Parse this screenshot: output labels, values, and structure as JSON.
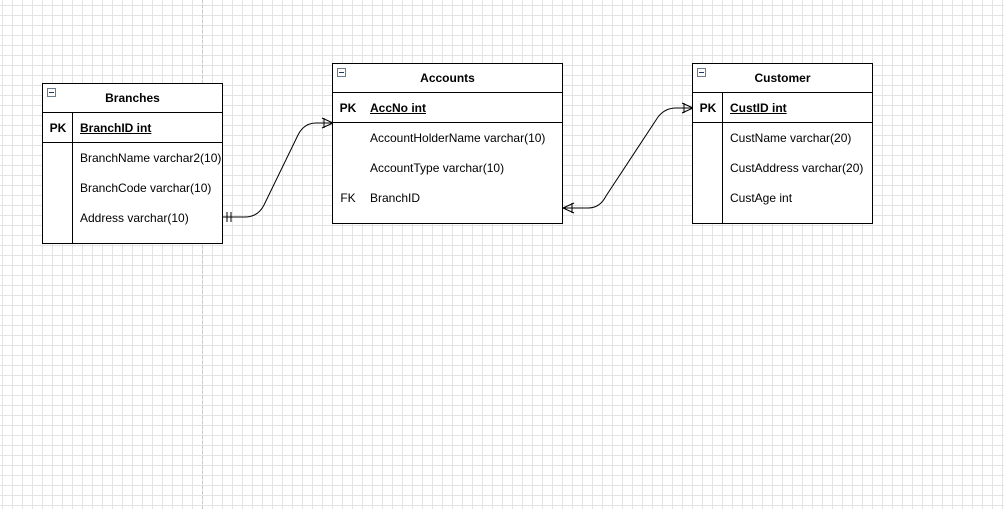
{
  "diagram": {
    "entities": [
      {
        "id": "branches",
        "title": "Branches",
        "pk": {
          "key": "PK",
          "field": "BranchID int"
        },
        "fields": [
          {
            "key": "",
            "field": "BranchName varchar2(10)"
          },
          {
            "key": "",
            "field": "BranchCode varchar(10)"
          },
          {
            "key": "",
            "field": "Address varchar(10)"
          }
        ]
      },
      {
        "id": "accounts",
        "title": "Accounts",
        "pk": {
          "key": "PK",
          "field": "AccNo int"
        },
        "fields": [
          {
            "key": "",
            "field": "AccountHolderName varchar(10)"
          },
          {
            "key": "",
            "field": "AccountType varchar(10)"
          },
          {
            "key": "FK",
            "field": "BranchID"
          }
        ]
      },
      {
        "id": "customer",
        "title": "Customer",
        "pk": {
          "key": "PK",
          "field": "CustID int"
        },
        "fields": [
          {
            "key": "",
            "field": "CustName varchar(20)"
          },
          {
            "key": "",
            "field": "CustAddress varchar(20)"
          },
          {
            "key": "",
            "field": "CustAge int"
          }
        ]
      }
    ],
    "relationships": [
      {
        "from": "branches.Address",
        "from_end": "one-and-only-one",
        "to": "accounts.AccNo",
        "to_end": "one-or-many"
      },
      {
        "from": "accounts.BranchID",
        "from_end": "one-or-many",
        "to": "customer.CustID",
        "to_end": "one-or-many"
      }
    ],
    "colors": {
      "line": "#000000",
      "grid": "#e4e4e4",
      "page_break": "#c8c8c8",
      "background": "#ffffff"
    }
  }
}
